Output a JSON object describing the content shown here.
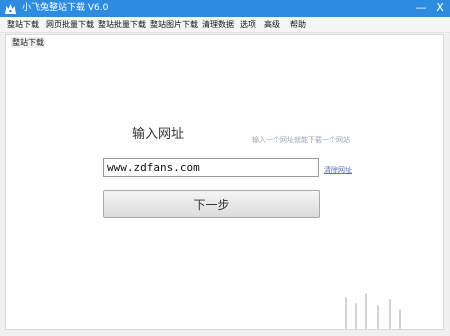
{
  "window": {
    "title": "小飞兔整站下载 V6.0",
    "minimize": "—",
    "close": "X",
    "accent_color": "#2d8ce0"
  },
  "menu": {
    "items": [
      {
        "label": "整站下载"
      },
      {
        "label": "网页批量下载"
      },
      {
        "label": "整站批量下载"
      },
      {
        "label": "整站图片下载"
      },
      {
        "label": "清理数据"
      },
      {
        "label": "选项"
      },
      {
        "label": "高级"
      },
      {
        "label": "帮助"
      }
    ]
  },
  "panel": {
    "group_label": "整站下载",
    "url_label": "输入网址",
    "hint": "输入一个网址就能下载一个网站",
    "url_value": "www.zdfans.com",
    "clear_link": "清除网址",
    "next_button": "下一步"
  }
}
